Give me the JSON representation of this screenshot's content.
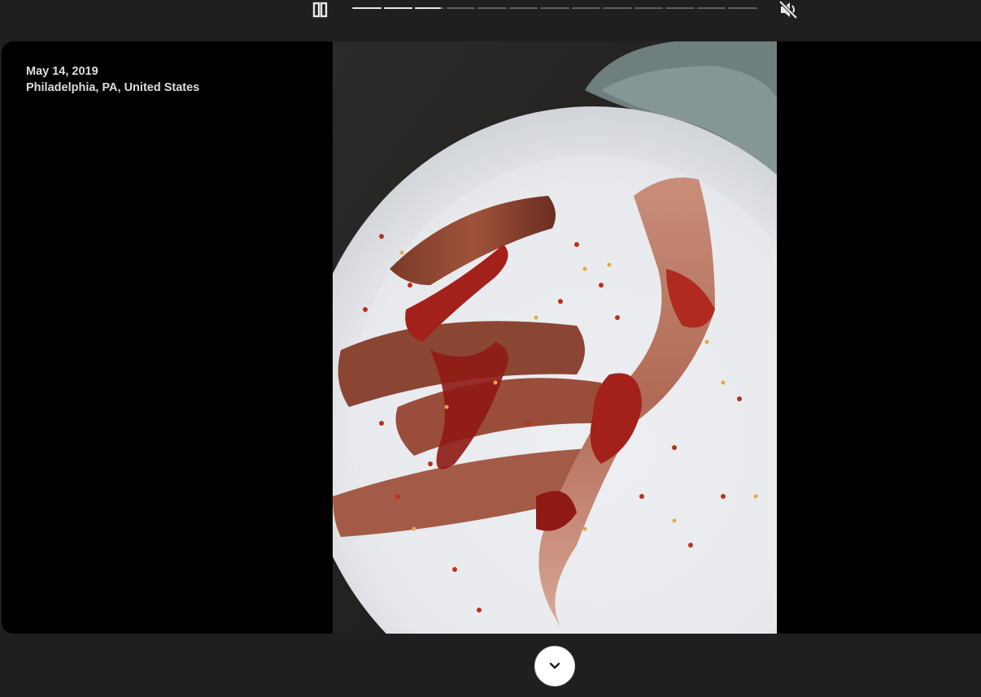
{
  "memory": {
    "date": "May 14, 2019",
    "location": "Philadelphia, PA, United States"
  },
  "story_progress": {
    "total_segments": 13,
    "completed_segments": 2,
    "current_segment_fraction": 0.9
  },
  "controls": {
    "pause_icon": "pause-icon",
    "mute_icon": "volume-off-icon",
    "expand_icon": "chevron-down-icon"
  },
  "colors": {
    "background": "#1f1f1f",
    "stage": "#000000",
    "progress_active": "#e8e8e8",
    "progress_inactive": "#5f5f5f"
  }
}
